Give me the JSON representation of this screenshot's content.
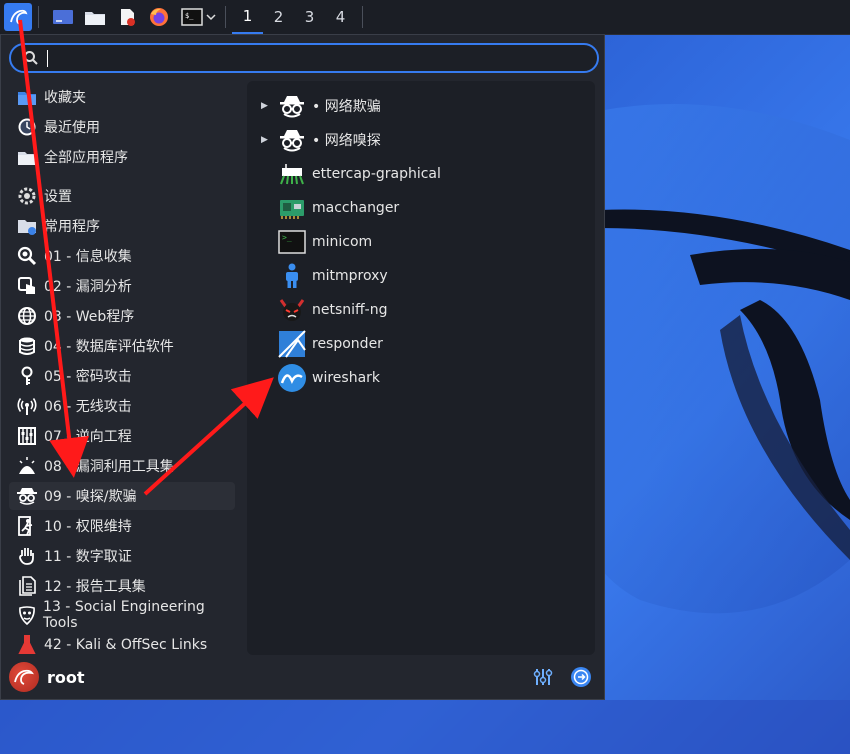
{
  "taskbar": {
    "workspaces": [
      "1",
      "2",
      "3",
      "4"
    ],
    "active_workspace": "1"
  },
  "search": {
    "placeholder": "",
    "value": ""
  },
  "categories": [
    {
      "label": "收藏夹",
      "icon": "folder-star-icon"
    },
    {
      "label": "最近使用",
      "icon": "clock-icon"
    },
    {
      "label": "全部应用程序",
      "icon": "folder-apps-icon"
    },
    {
      "label": "设置",
      "icon": "gear-icon"
    },
    {
      "label": "常用程序",
      "icon": "folder-user-icon"
    },
    {
      "label": "01 - 信息收集",
      "icon": "magnifier-icon"
    },
    {
      "label": "02 - 漏洞分析",
      "icon": "pointer-hand-icon"
    },
    {
      "label": "03 - Web程序",
      "icon": "globe-icon"
    },
    {
      "label": "04 - 数据库评估软件",
      "icon": "database-icon"
    },
    {
      "label": "05 - 密码攻击",
      "icon": "key-icon"
    },
    {
      "label": "06 - 无线攻击",
      "icon": "wireless-icon"
    },
    {
      "label": "07 - 逆向工程",
      "icon": "circuit-icon"
    },
    {
      "label": "08 - 漏洞利用工具集",
      "icon": "explosion-icon"
    },
    {
      "label": "09 - 嗅探/欺骗",
      "icon": "spy-icon"
    },
    {
      "label": "10 - 权限维持",
      "icon": "runner-icon"
    },
    {
      "label": "11 - 数字取证",
      "icon": "hand-icon"
    },
    {
      "label": "12 - 报告工具集",
      "icon": "documents-icon"
    },
    {
      "label": "13 - Social Engineering Tools",
      "icon": "social-mask-icon"
    },
    {
      "label": "42 - Kali & OffSec Links",
      "icon": "kali-flask-icon"
    }
  ],
  "selected_category": "09 - 嗅探/欺骗",
  "apps": [
    {
      "label": "• 网络欺骗",
      "icon": "spy-icon",
      "folder": true
    },
    {
      "label": "• 网络嗅探",
      "icon": "spy-icon",
      "folder": true
    },
    {
      "label": "ettercap-graphical",
      "icon": "ettercap-icon",
      "folder": false
    },
    {
      "label": "macchanger",
      "icon": "network-card-icon",
      "folder": false
    },
    {
      "label": "minicom",
      "icon": "terminal-icon",
      "folder": false
    },
    {
      "label": "mitmproxy",
      "icon": "person-icon",
      "folder": false
    },
    {
      "label": "netsniff-ng",
      "icon": "devil-icon",
      "folder": false
    },
    {
      "label": "responder",
      "icon": "responder-icon",
      "folder": false
    },
    {
      "label": "wireshark",
      "icon": "wireshark-fin-icon",
      "folder": false
    }
  ],
  "footer": {
    "username": "root"
  },
  "colors": {
    "accent": "#367bf0",
    "menu_bg": "#23262e",
    "annotation_red": "#ff1a1a"
  }
}
